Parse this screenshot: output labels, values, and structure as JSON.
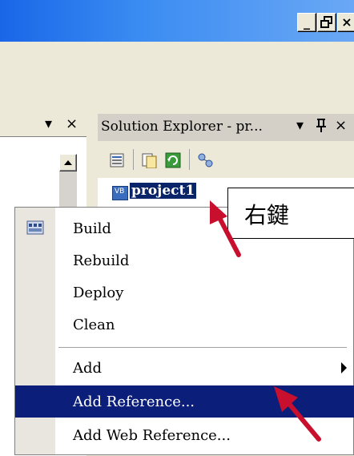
{
  "window": {
    "min_glyph": "_",
    "max_glyph": "Έ",
    "close_glyph": "×"
  },
  "left_pane": {
    "dropdown_glyph": "▾",
    "close_glyph": "×"
  },
  "solution_explorer": {
    "title": "Solution Explorer - pr...",
    "dropdown_glyph": "▾",
    "pin_glyph": "२",
    "close_glyph": "×",
    "project_label": "project1"
  },
  "callout": {
    "text": "右鍵"
  },
  "menu": {
    "items": [
      {
        "label": "Build"
      },
      {
        "label": "Rebuild"
      },
      {
        "label": "Deploy"
      },
      {
        "label": "Clean"
      },
      {
        "label": "Add"
      },
      {
        "label": "Add Reference..."
      },
      {
        "label": "Add Web Reference..."
      }
    ]
  },
  "colors": {
    "highlight": "#0a1e7a",
    "arrow": "#c8102e"
  }
}
